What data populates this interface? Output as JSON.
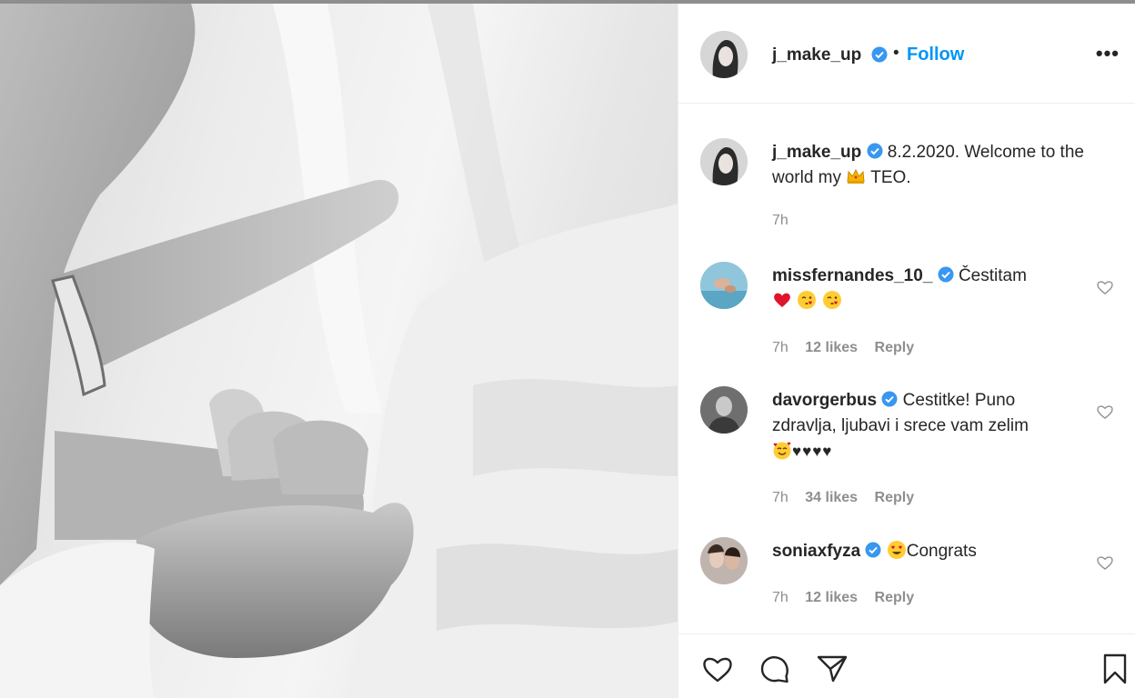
{
  "post": {
    "username": "j_make_up",
    "follow_label": "Follow",
    "separator": "•",
    "more_label": "•••"
  },
  "caption": {
    "username": "j_make_up",
    "text_before": "8.2.2020. Welcome to the world my",
    "text_after": "TEO.",
    "emoji": "crown",
    "time": "7h"
  },
  "comments": [
    {
      "username": "missfernandes_10_",
      "text": "Čestitam",
      "emojis": [
        "red-heart",
        "winking-kiss",
        "winking-kiss"
      ],
      "time": "7h",
      "likes": "12 likes",
      "reply": "Reply"
    },
    {
      "username": "davorgerbus",
      "text": "Cestitke! Puno zdravlja, ljubavi i srece vam zelim",
      "emojis": [
        "smiling-hearts",
        "black-heart",
        "black-heart",
        "black-heart",
        "black-heart"
      ],
      "time": "7h",
      "likes": "34 likes",
      "reply": "Reply"
    },
    {
      "username": "soniaxfyza",
      "text": "Congrats",
      "emojis": [
        "heart-eyes"
      ],
      "time": "7h",
      "likes": "12 likes",
      "reply": "Reply"
    }
  ],
  "icons": {
    "verified_color": "#3897f0",
    "link_color": "#0095f6",
    "muted_color": "#8e8e8e"
  }
}
